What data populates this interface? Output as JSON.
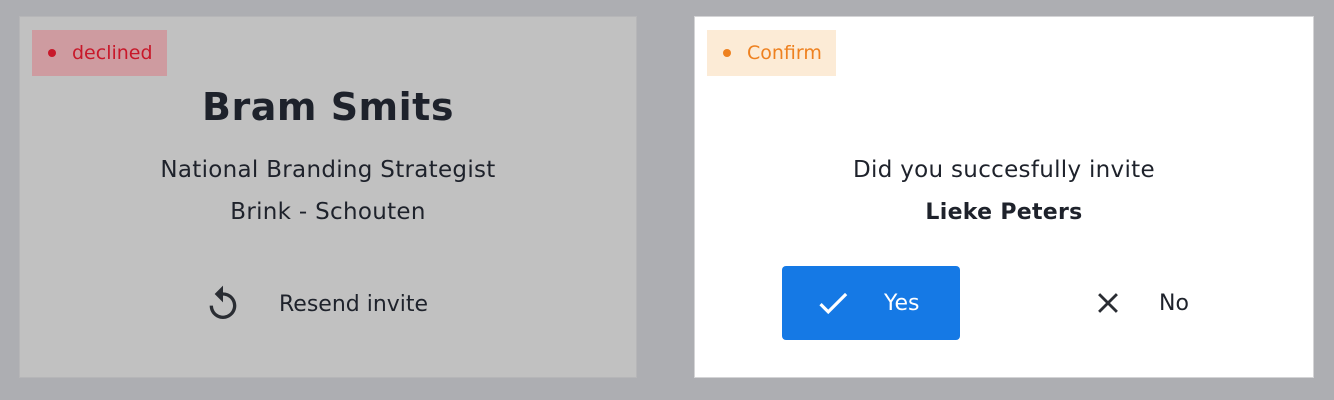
{
  "declined_card": {
    "status_label": "declined",
    "status_color": "#c8182a",
    "name": "Bram Smits",
    "job_title": "National Branding Strategist",
    "company": "Brink - Schouten",
    "resend_icon": "refresh-icon",
    "resend_label": "Resend invite"
  },
  "confirm_card": {
    "status_label": "Confirm",
    "status_color": "#ee8120",
    "question": "Did you succesfully invite",
    "person": "Lieke Peters",
    "yes_icon": "check-icon",
    "yes_label": "Yes",
    "yes_color": "#1579e5",
    "no_icon": "close-icon",
    "no_label": "No"
  }
}
